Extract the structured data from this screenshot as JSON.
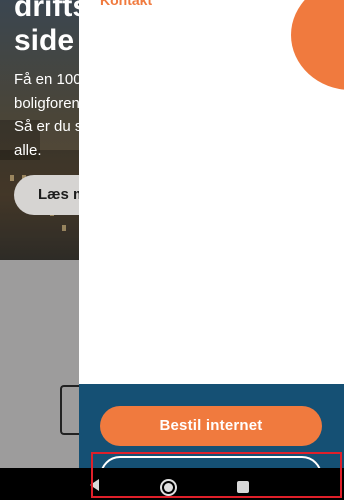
{
  "background_page": {
    "heading": "driftsikker\nside",
    "intro_text": "Få en 100\nboligforen\nSå er du s\nalle.",
    "read_more_label": "Læs m"
  },
  "drawer": {
    "contact_link": "Kontakt",
    "order_button_label": "Bestil internet"
  },
  "colors": {
    "accent": "#f07a3e",
    "footer_bg": "#155074",
    "highlight": "#e0202a"
  },
  "navbar": {
    "icons": [
      "back-icon",
      "home-icon",
      "recents-icon"
    ]
  }
}
